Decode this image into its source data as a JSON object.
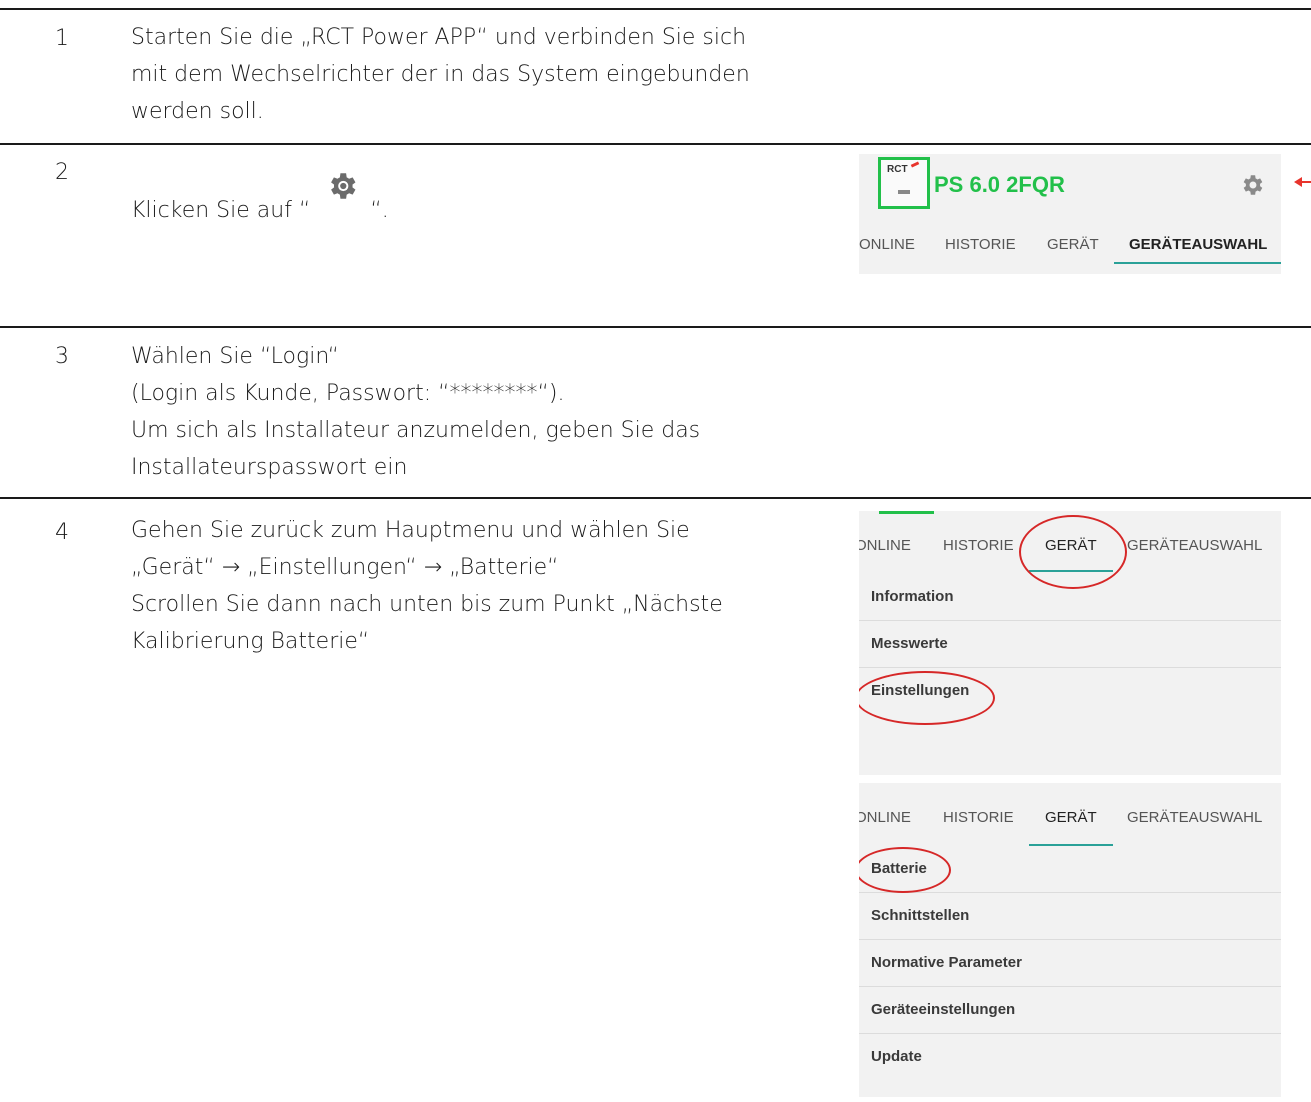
{
  "steps": [
    {
      "num": "1",
      "lines": [
        "Starten Sie die „RCT Power APP“ und verbinden Sie sich",
        "mit dem Wechselrichter der in das System eingebunden",
        "werden soll."
      ]
    },
    {
      "num": "2",
      "before": "Klicken Sie auf “",
      "after": "“."
    },
    {
      "num": "3",
      "lines": [
        "Wählen Sie “Login“",
        "(Login als Kunde, Passwort: “********“).",
        "Um sich als Installateur anzumelden, geben Sie das",
        "Installateurspasswort ein"
      ]
    },
    {
      "num": "4",
      "lines": [
        "Gehen Sie zurück zum Hauptmenu und wählen Sie",
        "„Gerät“ → „Einstellungen“ → „Batterie“",
        "Scrollen Sie dann nach unten bis zum Punkt „Nächste",
        "Kalibrierung Batterie“"
      ]
    }
  ],
  "app_header": {
    "logo_text": "RCT",
    "device_name": "PS 6.0 2FQR",
    "tabs": [
      "ONLINE",
      "HISTORIE",
      "GERÄT",
      "GERÄTEAUSWAHL"
    ],
    "active_tab": "GERÄTEAUSWAHL"
  },
  "shot_device": {
    "tabs": [
      "ONLINE",
      "HISTORIE",
      "GERÄT",
      "GERÄTEAUSWAHL"
    ],
    "active_tab": "GERÄT",
    "items": [
      "Information",
      "Messwerte",
      "Einstellungen"
    ]
  },
  "shot_settings": {
    "tabs": [
      "ONLINE",
      "HISTORIE",
      "GERÄT",
      "GERÄTEAUSWAHL"
    ],
    "active_tab": "GERÄT",
    "items": [
      "Batterie",
      "Schnittstellen",
      "Normative Parameter",
      "Geräteeinstellungen",
      "Update"
    ]
  },
  "colors": {
    "accent_green": "#22c04a",
    "tab_indicator": "#2aa198",
    "highlight_red": "#d62828",
    "arrow_red": "#e8342c"
  }
}
